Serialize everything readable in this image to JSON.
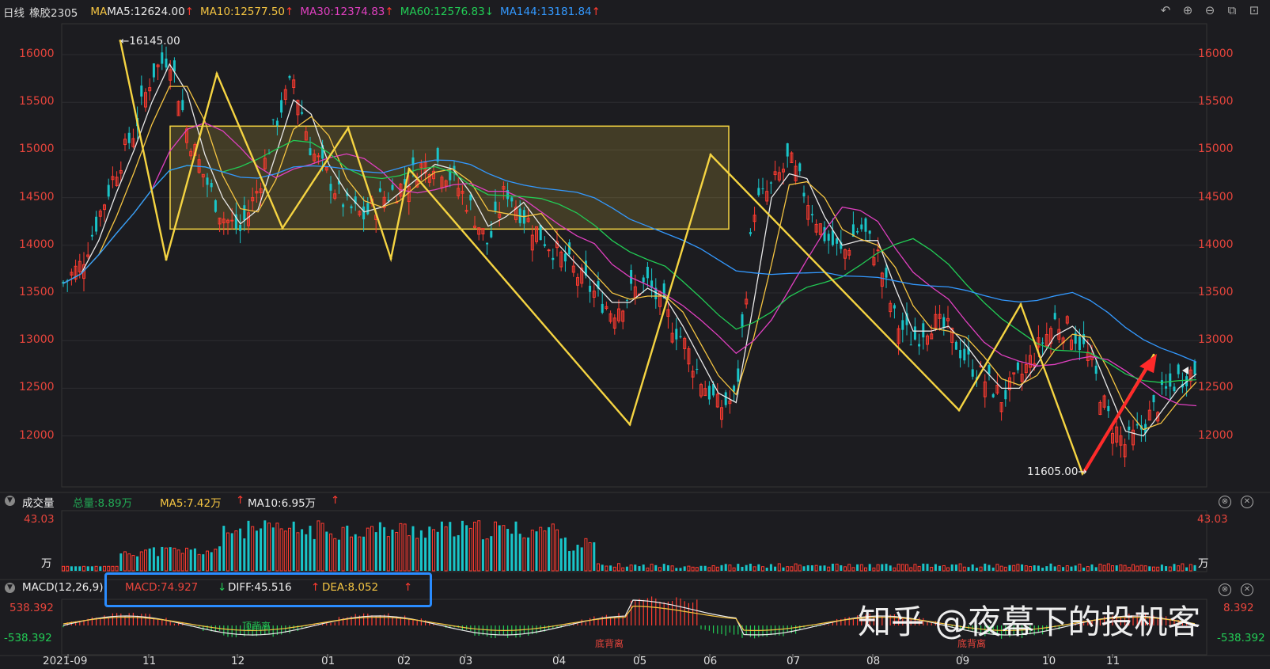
{
  "header": {
    "period": "日线",
    "symbol": "橡胶2305",
    "ma_label": "MA",
    "ma": [
      {
        "text": "MA5:12624.00",
        "dir": "↑",
        "color": "#e8e8e8"
      },
      {
        "text": "MA10:12577.50",
        "dir": "↑",
        "color": "#f5c542"
      },
      {
        "text": "MA30:12374.83",
        "dir": "↑",
        "color": "#e040c0"
      },
      {
        "text": "MA60:12576.83",
        "dir": "↓",
        "color": "#22cc55"
      },
      {
        "text": "MA144:13181.84",
        "dir": "↑",
        "color": "#3399ff"
      }
    ],
    "tools": [
      "undo-icon",
      "zoom-in-icon",
      "zoom-out-icon",
      "layout-icon",
      "more-icon"
    ]
  },
  "price_axis": {
    "ticks": [
      "16000",
      "15500",
      "15000",
      "14500",
      "14000",
      "13500",
      "13000",
      "12500",
      "12000"
    ]
  },
  "annotations": {
    "high": "←16145.00",
    "low": "11605.00→"
  },
  "volume_panel": {
    "title": "成交量",
    "total": "总量:8.89万",
    "ma5": "MA5:7.42万",
    "ma10": "MA10:6.95万",
    "ma10_dir": "↑",
    "ma10_dir2": "↑",
    "top_label": "43.03",
    "unit": "万"
  },
  "macd_panel": {
    "title": "MACD(12,26,9)",
    "macd": "MACD:74.927",
    "diff": "DIFF:45.516",
    "diff_dir": "↓",
    "dea": "DEA:8.052",
    "dea_dir": "↑",
    "dea_dir2": "↑",
    "top": "538.392",
    "bottom": "-538.392",
    "right_top": "8.392",
    "divergence": "底背离",
    "divergence2": "顶背离"
  },
  "x_axis": {
    "ticks": [
      "2021-09",
      "11",
      "12",
      "01",
      "02",
      "03",
      "04",
      "05",
      "06",
      "07",
      "08",
      "09",
      "10",
      "11"
    ]
  },
  "watermark": "知乎 @夜幕下的投机客",
  "colors": {
    "up": "#ff3b30",
    "down": "#19c5c9",
    "zigzag": "#f5d442",
    "box": "#f5d442"
  },
  "chart_data": {
    "type": "candlestick",
    "title": "橡胶2305",
    "ylim": [
      11500,
      16300
    ],
    "x_ticks": [
      "2021-09",
      "11",
      "12",
      "01",
      "02",
      "03",
      "04",
      "05",
      "06",
      "07",
      "08",
      "09",
      "10",
      "11"
    ],
    "close_path": [
      [
        "2021-09",
        13600
      ],
      [
        "2021-09",
        13800
      ],
      [
        "2021-09",
        14300
      ],
      [
        "2021-09",
        14800
      ],
      [
        "10",
        15200
      ],
      [
        "10",
        15800
      ],
      [
        "10",
        16000
      ],
      [
        "10",
        15200
      ],
      [
        "10",
        14700
      ],
      [
        "11",
        14300
      ],
      [
        "11",
        14150
      ],
      [
        "11",
        14600
      ],
      [
        "11",
        15300
      ],
      [
        "11",
        15750
      ],
      [
        "12",
        15000
      ],
      [
        "12",
        14700
      ],
      [
        "12",
        14400
      ],
      [
        "12",
        14300
      ],
      [
        "12",
        14500
      ],
      [
        "01",
        14600
      ],
      [
        "01",
        14800
      ],
      [
        "01",
        14900
      ],
      [
        "01",
        14700
      ],
      [
        "01",
        14400
      ],
      [
        "02",
        14000
      ],
      [
        "02",
        14600
      ],
      [
        "02",
        14300
      ],
      [
        "02",
        14100
      ],
      [
        "03",
        13900
      ],
      [
        "03",
        13700
      ],
      [
        "03",
        13500
      ],
      [
        "03",
        13300
      ],
      [
        "04",
        13500
      ],
      [
        "04",
        13600
      ],
      [
        "04",
        13300
      ],
      [
        "04",
        13000
      ],
      [
        "04",
        12600
      ],
      [
        "05",
        12300
      ],
      [
        "05",
        12400
      ],
      [
        "05",
        14400
      ],
      [
        "05",
        14600
      ],
      [
        "06",
        14900
      ],
      [
        "06",
        14500
      ],
      [
        "06",
        14100
      ],
      [
        "06",
        13900
      ],
      [
        "07",
        14200
      ],
      [
        "07",
        13900
      ],
      [
        "07",
        13200
      ],
      [
        "07",
        13000
      ],
      [
        "08",
        13200
      ],
      [
        "08",
        13100
      ],
      [
        "08",
        12800
      ],
      [
        "08",
        12600
      ],
      [
        "09",
        12400
      ],
      [
        "09",
        12600
      ],
      [
        "09",
        12900
      ],
      [
        "09",
        13200
      ],
      [
        "10",
        13100
      ],
      [
        "10",
        12800
      ],
      [
        "10",
        12200
      ],
      [
        "10",
        11900
      ],
      [
        "11",
        12100
      ],
      [
        "11",
        12400
      ],
      [
        "11",
        12600
      ],
      [
        "11",
        12700
      ]
    ],
    "ma_values": {
      "MA5": 12624.0,
      "MA10": 12577.5,
      "MA30": 12374.83,
      "MA60": 12576.83,
      "MA144": 13181.84
    },
    "high": 16145.0,
    "low": 11605.0,
    "consolidation_box": {
      "from": "11",
      "to": "06",
      "top": 15250,
      "bottom": 14170
    },
    "zigzag_pivots": [
      [
        "10",
        16145
      ],
      [
        "11",
        13850
      ],
      [
        "11",
        15800
      ],
      [
        "12",
        14180
      ],
      [
        "01",
        15230
      ],
      [
        "02",
        13860
      ],
      [
        "02",
        14800
      ],
      [
        "05",
        12120
      ],
      [
        "06",
        14950
      ],
      [
        "09",
        12270
      ],
      [
        "10",
        13380
      ],
      [
        "11",
        11605
      ],
      [
        "11",
        12850
      ]
    ],
    "volume": {
      "max": 43.03,
      "unit": "万",
      "total": 8.89,
      "ma5": 7.42,
      "ma10": 6.95
    },
    "macd": {
      "macd": 74.927,
      "diff": 45.516,
      "dea": 8.052,
      "range": [
        -538.392,
        538.392
      ]
    }
  }
}
